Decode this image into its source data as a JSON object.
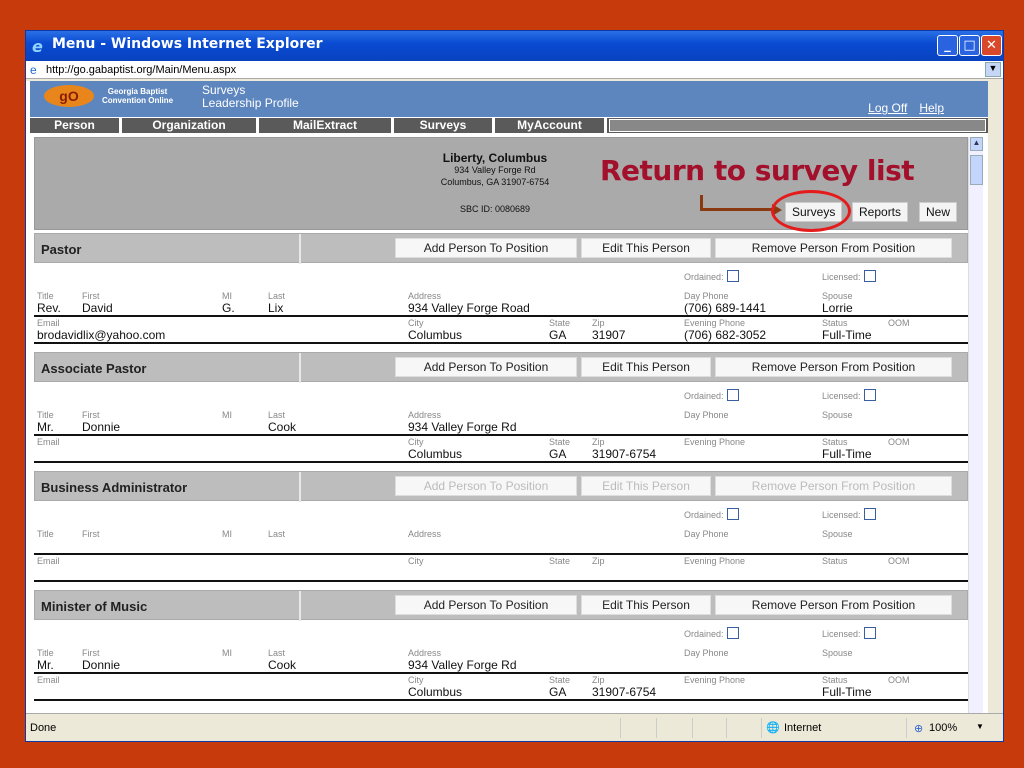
{
  "window": {
    "title": "Menu - Windows Internet Explorer",
    "url": "http://go.gabaptist.org/Main/Menu.aspx"
  },
  "header": {
    "logo": "gO",
    "org_line1": "Georgia Baptist",
    "org_line2": "Convention Online",
    "app_line1": "Surveys",
    "app_line2": "Leadership Profile",
    "logoff": "Log Off",
    "help": "Help"
  },
  "menu": [
    "Person",
    "Organization",
    "MailExtract",
    "Surveys",
    "MyAccount"
  ],
  "church": {
    "name": "Liberty, Columbus",
    "street": "934 Valley Forge Rd",
    "citystate": "Columbus, GA 31907-6754",
    "sbc": "SBC ID: 0080689",
    "surveys": "Surveys",
    "reports": "Reports",
    "new": "New"
  },
  "annotation": "Return to survey list",
  "labels": {
    "title": "Title",
    "first": "First",
    "mi": "MI",
    "last": "Last",
    "address": "Address",
    "day_phone": "Day Phone",
    "spouse": "Spouse",
    "ordained": "Ordained:",
    "licensed": "Licensed:",
    "email": "Email",
    "city": "City",
    "state": "State",
    "zip": "Zip",
    "evening_phone": "Evening Phone",
    "status": "Status",
    "oom": "OOM",
    "add": "Add Person To Position",
    "edit": "Edit This Person",
    "remove": "Remove Person From Position"
  },
  "positions": [
    {
      "name": "Pastor",
      "enabled": true,
      "title": "Rev.",
      "first": "David",
      "mi": "G.",
      "last": "Lix",
      "address": "934 Valley Forge Road",
      "day_phone": "(706) 689-1441",
      "spouse": "Lorrie",
      "email": "brodavidlix@yahoo.com",
      "city": "Columbus",
      "state": "GA",
      "zip": "31907",
      "evening_phone": "(706) 682-3052",
      "status": "Full-Time"
    },
    {
      "name": "Associate Pastor",
      "enabled": true,
      "title": "Mr.",
      "first": "Donnie",
      "mi": "",
      "last": "Cook",
      "address": "934 Valley Forge Rd",
      "day_phone": "",
      "spouse": "",
      "email": "",
      "city": "Columbus",
      "state": "GA",
      "zip": "31907-6754",
      "evening_phone": "",
      "status": "Full-Time"
    },
    {
      "name": "Business Administrator",
      "enabled": false,
      "title": "",
      "first": "",
      "mi": "",
      "last": "",
      "address": "",
      "day_phone": "",
      "spouse": "",
      "email": "",
      "city": "",
      "state": "",
      "zip": "",
      "evening_phone": "",
      "status": ""
    },
    {
      "name": "Minister of Music",
      "enabled": true,
      "title": "Mr.",
      "first": "Donnie",
      "mi": "",
      "last": "Cook",
      "address": "934 Valley Forge Rd",
      "day_phone": "",
      "spouse": "",
      "email": "",
      "city": "Columbus",
      "state": "GA",
      "zip": "31907-6754",
      "evening_phone": "",
      "status": "Full-Time"
    }
  ],
  "status": {
    "text": "Done",
    "zone": "Internet",
    "zoom": "100%"
  }
}
